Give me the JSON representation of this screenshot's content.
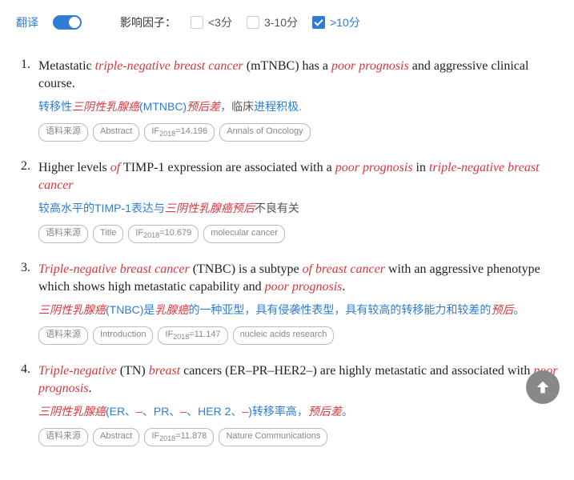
{
  "filterBar": {
    "translateLabel": "翻译",
    "factorLabel": "影响因子：",
    "opt1": "<3分",
    "opt2": "3-10分",
    "opt3": ">10分"
  },
  "entries": [
    {
      "num": "1.",
      "en_p1": "Metastatic ",
      "en_h1": "triple-negative breast cancer",
      "en_p2": " (mTNBC) has a ",
      "en_h2": "poor prognosis",
      "en_p3": " and aggressive clinical course.",
      "cn_p1": "转移性",
      "cn_h1": "三阴性乳腺癌",
      "cn_p2": "(MTNBC)",
      "cn_h2": "预后差",
      "cn_p3": "，",
      "cn_plain": "临床",
      "cn_p4": "进程积极.",
      "tag1": "语料来源",
      "tag2": "Abstract",
      "tag3a": "IF",
      "tag3b": "2018",
      "tag3c": "=14.196",
      "tag4": "Annals of Oncology"
    },
    {
      "num": "2.",
      "en_p1": "Higher levels ",
      "en_h1": "of",
      "en_p2": " TIMP-1 expression are associated with a ",
      "en_h2": "poor prognosis",
      "en_p3": " in ",
      "en_h3": "triple-negative breast cancer",
      "cn_p1": "较高水平的TIMP-1表达与",
      "cn_h1": "三阴性乳腺癌预后",
      "cn_plain": "不良有关",
      "tag1": "语料来源",
      "tag2": "Title",
      "tag3a": "IF",
      "tag3b": "2018",
      "tag3c": "=10.679",
      "tag4": "molecular cancer"
    },
    {
      "num": "3.",
      "en_h1": "Triple-negative breast cancer",
      "en_p1": " (TNBC) is a subtype ",
      "en_h2": "of breast cancer",
      "en_p2": " with an aggressive phenotype which shows high metastatic capability and ",
      "en_h3": "poor prognosis",
      "en_p3": ".",
      "cn_h1": "三阴性乳腺癌",
      "cn_p1": "(TNBC)是",
      "cn_h2": "乳腺癌",
      "cn_p2": "的一种亚型，具有侵袭性表型，具有较高的转移能力和较差的",
      "cn_h3": "预后",
      "cn_p3": "。",
      "tag1": "语料来源",
      "tag2": "Introduction",
      "tag3a": "IF",
      "tag3b": "2018",
      "tag3c": "=11.147",
      "tag4": "nucleic acids research"
    },
    {
      "num": "4.",
      "en_h1": "Triple-negative",
      "en_p1": " (TN) ",
      "en_h2": "breast",
      "en_p2": " cancers (ER–PR–HER2–) are highly metastatic and associated with ",
      "en_h3": "poor prognosis",
      "en_p3": ".",
      "cn_h1": "三阴性乳腺癌",
      "cn_p1": "(ER、",
      "cn_h2": "–",
      "cn_p2": "、PR、",
      "cn_h3": "–",
      "cn_p3": "、HER 2、",
      "cn_h4": "–",
      "cn_p4": ")转移率高，",
      "cn_h5": "预后差",
      "cn_p5": "。",
      "tag1": "语料来源",
      "tag2": "Abstract",
      "tag3a": "IF",
      "tag3b": "2018",
      "tag3c": "=11.878",
      "tag4": "Nature Communications"
    }
  ]
}
